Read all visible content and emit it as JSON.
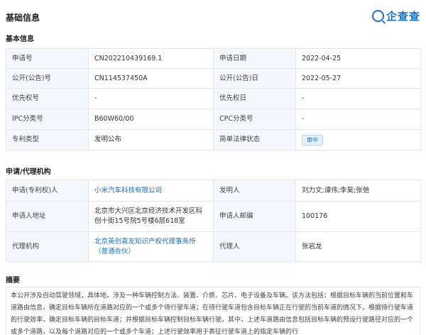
{
  "page_title": "基础信息",
  "brand": {
    "name": "企查查",
    "icon": "search-magnifier-icon",
    "color": "#1b6fd1"
  },
  "basic": {
    "title": "基本信息",
    "rows": [
      {
        "l1": "申请号",
        "v1": "CN202210439169.1",
        "l2": "申请日期",
        "v2": "2022-04-25"
      },
      {
        "l1": "公开(公告)号",
        "v1": "CN114537450A",
        "l2": "公开(公告)日",
        "v2": "2022-05-27"
      },
      {
        "l1": "优先权号",
        "v1": "-",
        "l2": "优先权日",
        "v2": "-"
      },
      {
        "l1": "IPC分类号",
        "v1": "B60W60/00",
        "l2": "CPC分类号",
        "v2": "-"
      },
      {
        "l1": "专利类型",
        "v1": "发明公布",
        "l2": "简单法律状态",
        "v2": "审中"
      }
    ]
  },
  "applicant": {
    "title": "申请/代理机构",
    "rows": [
      {
        "l1": "申请(专利权)人",
        "v1": "小米汽车科技有限公司",
        "l2": "发明人",
        "v2": "刘力文;谭伟;李昊;张弛"
      },
      {
        "l1": "申请人地址",
        "v1": "北京市大兴区北京经济技术开发区科创十街15号院5号楼6层618室",
        "l2": "申请人邮编",
        "v2": "100176"
      },
      {
        "l1": "代理机构",
        "v1": "北京英创嘉友知识产权代理事务所（普通合伙）",
        "l2": "代理人",
        "v2": "张岩龙"
      }
    ]
  },
  "abstract": {
    "title": "摘要",
    "text": "本公开涉及自动驾驶领域，具体地，涉及一种车辆控制方法、装置、介质、芯片、电子设备及车辆。该方法包括：根据目标车辆的当前位置和车道路由信息，确定目标车辆所在道路对应的一个或多个待行驶车道；在待行驶车道包含目标车辆正在行驶的当前车道的情况下，根据待行驶车道的行驶效率，确定目标车辆的目标车道；并根据目标车辆控制目标车辆行驶。其中，上述车道路由信息包括目标车辆的预设行驶路径对应的一个或多个道路，以及每个道路对应的一个或多个车道；上述行驶效率用于表征行驶车道上的指定车辆的行"
  }
}
